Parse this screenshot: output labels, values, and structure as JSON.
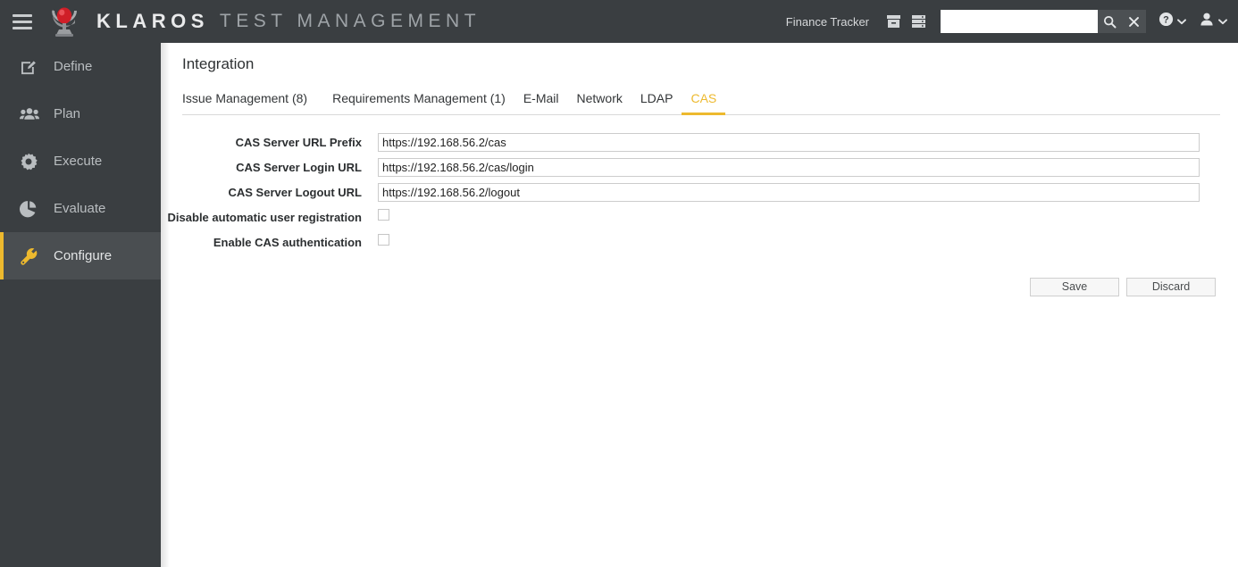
{
  "topbar": {
    "menu_icon": "hamburger-icon",
    "logo_icon": "klaros-logo-icon",
    "brand_primary": "KLAROS",
    "brand_secondary": "TEST MANAGEMENT",
    "project_name": "Finance Tracker",
    "archive_icon": "archive-box-icon",
    "database_icon": "database-server-icon",
    "search_value": "",
    "search_placeholder": "",
    "search_icon": "search-icon",
    "clear_icon": "close-x-icon",
    "help_icon": "help-circle-icon",
    "help_caret_icon": "chevron-down-icon",
    "user_icon": "user-avatar-icon",
    "user_caret_icon": "chevron-down-icon",
    "bg_color": "#3a3e41",
    "accent_color": "#edb92e"
  },
  "sidebar": {
    "items": [
      {
        "label": "Define",
        "icon": "edit-square-icon",
        "active": false
      },
      {
        "label": "Plan",
        "icon": "users-group-icon",
        "active": false
      },
      {
        "label": "Execute",
        "icon": "gear-icon",
        "active": false
      },
      {
        "label": "Evaluate",
        "icon": "pie-chart-icon",
        "active": false
      },
      {
        "label": "Configure",
        "icon": "wrench-icon",
        "active": true
      }
    ]
  },
  "main": {
    "page_title": "Integration",
    "tabs": [
      {
        "label": "Issue Management (8)",
        "active": false
      },
      {
        "label": "Requirements Management (1)",
        "active": false
      },
      {
        "label": "E-Mail",
        "active": false
      },
      {
        "label": "Network",
        "active": false
      },
      {
        "label": "LDAP",
        "active": false
      },
      {
        "label": "CAS",
        "active": true
      }
    ],
    "form": {
      "fields": [
        {
          "label": "CAS Server URL Prefix",
          "type": "text",
          "value": "https://192.168.56.2/cas"
        },
        {
          "label": "CAS Server Login URL",
          "type": "text",
          "value": "https://192.168.56.2/cas/login"
        },
        {
          "label": "CAS Server Logout URL",
          "type": "text",
          "value": "https://192.168.56.2/logout"
        },
        {
          "label": "Disable automatic user registration",
          "type": "checkbox",
          "checked": false
        },
        {
          "label": "Enable CAS authentication",
          "type": "checkbox",
          "checked": false
        }
      ]
    },
    "buttons": {
      "save_label": "Save",
      "discard_label": "Discard"
    }
  }
}
